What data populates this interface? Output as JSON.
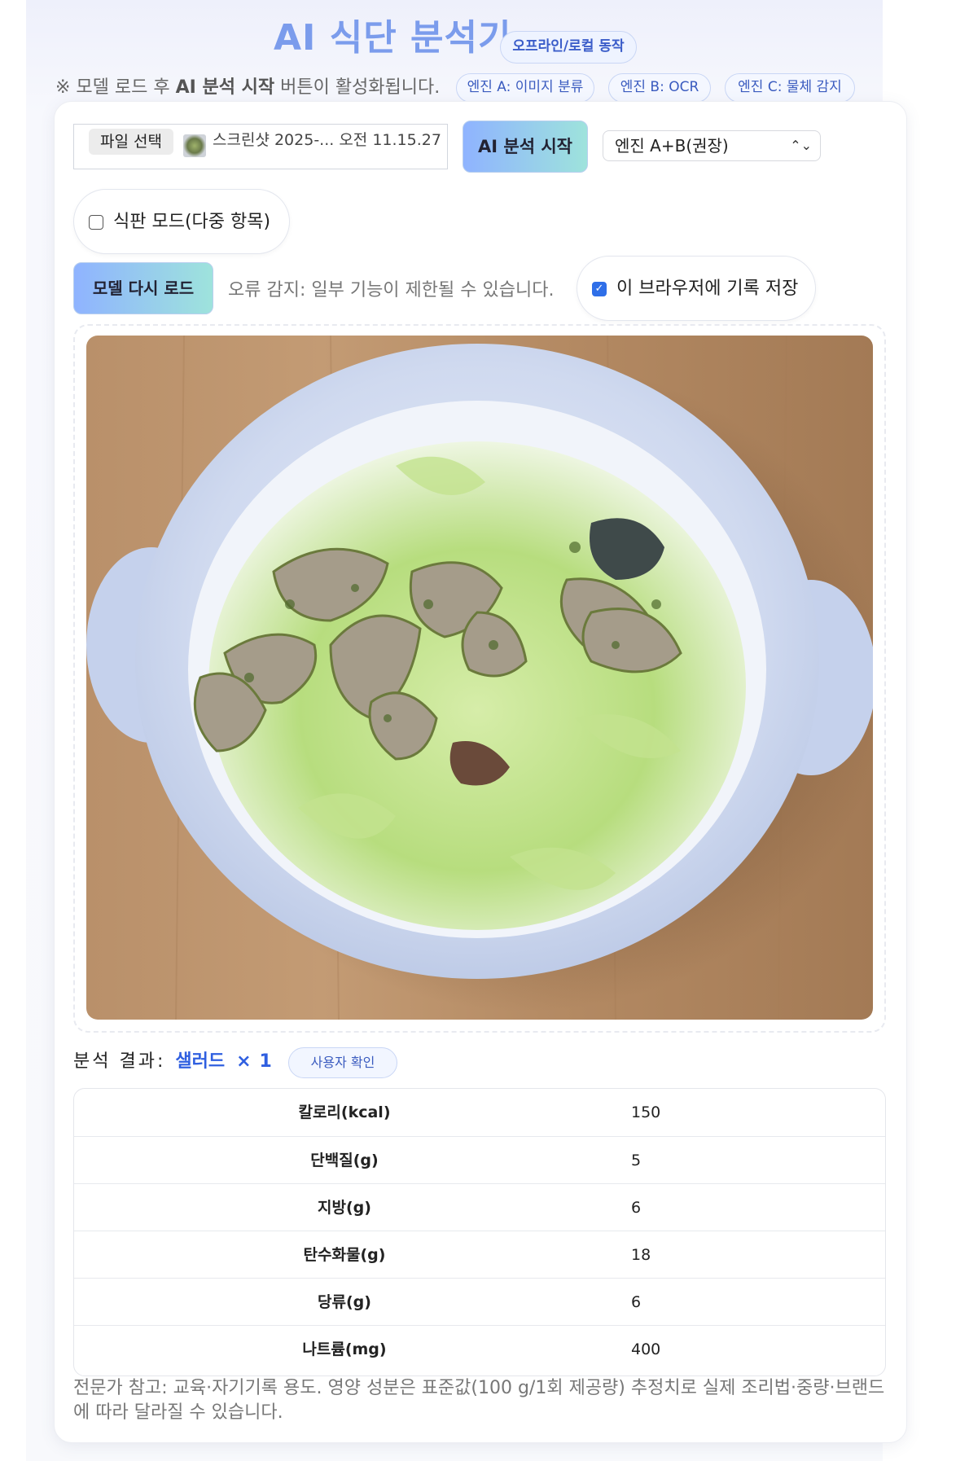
{
  "header": {
    "title": "AI 식단 분석기",
    "offline_badge": "오프라인/로컬 동작"
  },
  "notice": {
    "prefix": "※ 모델 로드 후 ",
    "bold": "AI 분석 시작",
    "suffix": " 버튼이 활성화됩니다."
  },
  "engines": {
    "a": "엔진 A: 이미지 분류",
    "b": "엔진 B: OCR",
    "c": "엔진 C: 물체 감지"
  },
  "controls": {
    "file_button": "파일 선택",
    "file_name": "스크린샷 2025-... 오전 11.15.27",
    "analyze_button": "AI 분석 시작",
    "engine_select": "엔진 A+B(권장)",
    "plate_mode_label": "식판 모드(다중 항목)",
    "plate_mode_checked": false,
    "reload_button": "모델 다시 로드",
    "error_text": "오류 감지: 일부 기능이 제한될 수 있습니다.",
    "save_label": "이 브라우저에 기록 저장",
    "save_checked": true
  },
  "result": {
    "label": "분석 결과:",
    "food": "샐러드",
    "times": "×",
    "quantity": "1",
    "confirm_badge": "사용자 확인"
  },
  "nutrition": [
    {
      "label": "칼로리(kcal)",
      "value": "150"
    },
    {
      "label": "단백질(g)",
      "value": "5"
    },
    {
      "label": "지방(g)",
      "value": "6"
    },
    {
      "label": "탄수화물(g)",
      "value": "18"
    },
    {
      "label": "당류(g)",
      "value": "6"
    },
    {
      "label": "나트륨(mg)",
      "value": "400"
    }
  ],
  "footnote": "전문가 참고: 교육·자기기록 용도. 영양 성분은 표준값(100 g/1회 제공량) 추정치로 실제 조리법·중량·브랜드에 따라 달라질 수 있습니다.",
  "colors": {
    "title": "#7b9cec",
    "accent": "#2f5fe0",
    "button_gradient_start": "#8fb3ff",
    "button_gradient_end": "#9ee3dc"
  }
}
